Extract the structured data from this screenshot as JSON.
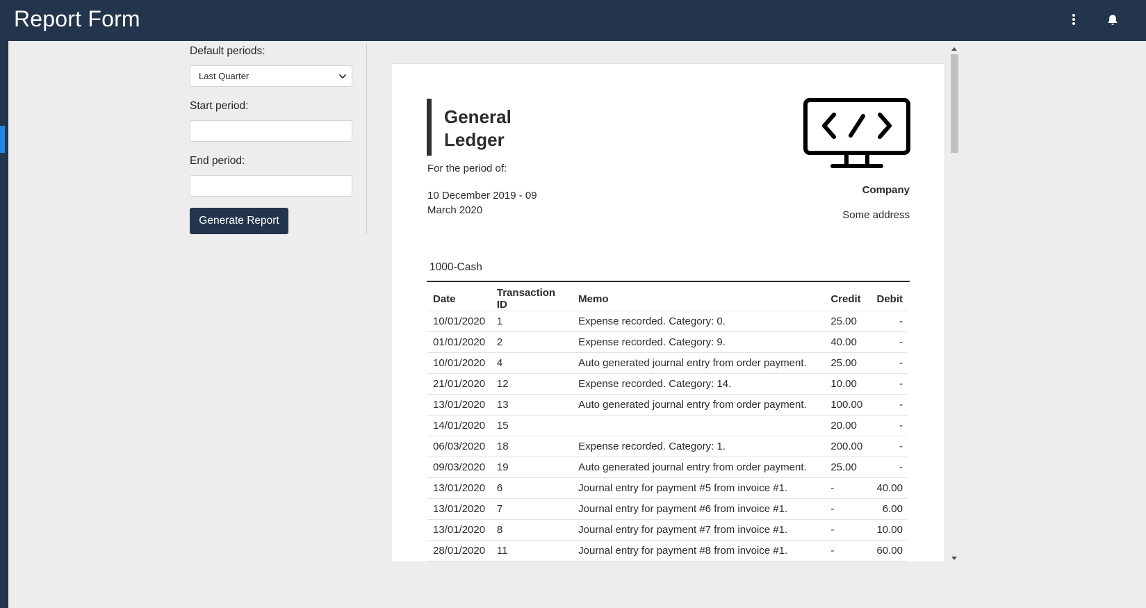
{
  "header": {
    "title": "Report Form",
    "more_icon": "more-vert-icon",
    "bell_icon": "bell-icon"
  },
  "colors": {
    "navbar": "#22354c",
    "accent": "#1e88e5"
  },
  "form": {
    "default_periods_label": "Default periods:",
    "default_periods_value": "Last Quarter",
    "start_label": "Start period:",
    "start_value": "",
    "end_label": "End period:",
    "end_value": "",
    "generate_label": "Generate Report"
  },
  "report": {
    "title": "General Ledger",
    "period_label": "For the period of:",
    "period_value": "10 December 2019 - 09 March 2020",
    "logo_icon": "code-monitor-icon",
    "company": "Company",
    "address": "Some address",
    "account": "1000-Cash",
    "columns": [
      "Date",
      "Transaction ID",
      "Memo",
      "Credit",
      "Debit"
    ],
    "rows": [
      [
        "10/01/2020",
        "1",
        "Expense recorded. Category: 0.",
        "25.00",
        "-"
      ],
      [
        "01/01/2020",
        "2",
        "Expense recorded. Category: 9.",
        "40.00",
        "-"
      ],
      [
        "10/01/2020",
        "4",
        "Auto generated journal entry from order payment.",
        "25.00",
        "-"
      ],
      [
        "21/01/2020",
        "12",
        "Expense recorded. Category: 14.",
        "10.00",
        "-"
      ],
      [
        "13/01/2020",
        "13",
        "Auto generated journal entry from order payment.",
        "100.00",
        "-"
      ],
      [
        "14/01/2020",
        "15",
        "",
        "20.00",
        "-"
      ],
      [
        "06/03/2020",
        "18",
        "Expense recorded. Category: 1.",
        "200.00",
        "-"
      ],
      [
        "09/03/2020",
        "19",
        "Auto generated journal entry from order payment.",
        "25.00",
        "-"
      ],
      [
        "13/01/2020",
        "6",
        "Journal entry for payment #5 from invoice #1.",
        "-",
        "40.00"
      ],
      [
        "13/01/2020",
        "7",
        "Journal entry for payment #6 from invoice #1.",
        "-",
        "6.00"
      ],
      [
        "13/01/2020",
        "8",
        "Journal entry for payment #7 from invoice #1.",
        "-",
        "10.00"
      ],
      [
        "28/01/2020",
        "11",
        "Journal entry for payment #8 from invoice #1.",
        "-",
        "60.00"
      ]
    ]
  }
}
